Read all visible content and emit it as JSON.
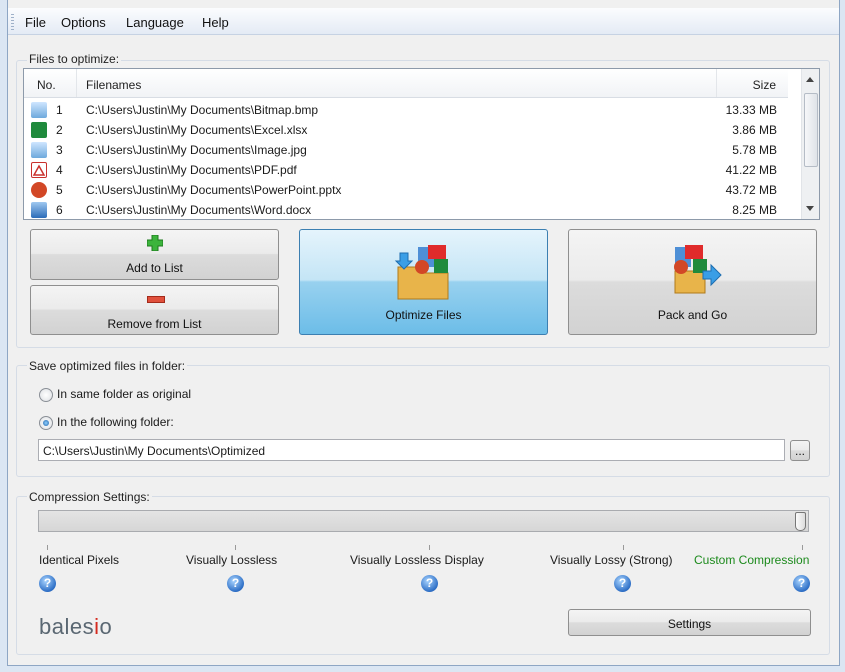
{
  "menu": [
    "File",
    "Options",
    "Language",
    "Help"
  ],
  "files_group": {
    "title": "Files to optimize:",
    "columns": {
      "no": "No.",
      "filename": "Filenames",
      "size": "Size"
    },
    "rows": [
      {
        "no": "1",
        "name": "C:\\Users\\Justin\\My Documents\\Bitmap.bmp",
        "size": "13.33 MB",
        "icon": "image-icon"
      },
      {
        "no": "2",
        "name": "C:\\Users\\Justin\\My Documents\\Excel.xlsx",
        "size": "3.86 MB",
        "icon": "excel-icon"
      },
      {
        "no": "3",
        "name": "C:\\Users\\Justin\\My Documents\\Image.jpg",
        "size": "5.78 MB",
        "icon": "image-icon"
      },
      {
        "no": "4",
        "name": "C:\\Users\\Justin\\My Documents\\PDF.pdf",
        "size": "41.22 MB",
        "icon": "pdf-icon"
      },
      {
        "no": "5",
        "name": "C:\\Users\\Justin\\My Documents\\PowerPoint.pptx",
        "size": "43.72 MB",
        "icon": "powerpoint-icon"
      },
      {
        "no": "6",
        "name": "C:\\Users\\Justin\\My Documents\\Word.docx",
        "size": "8.25 MB",
        "icon": "word-icon"
      }
    ],
    "buttons": {
      "add": "Add to List",
      "remove": "Remove from List",
      "optimize": "Optimize Files",
      "pack": "Pack and Go"
    }
  },
  "folder_group": {
    "title": "Save optimized files in folder:",
    "option_same": "In same folder as original",
    "option_following": "In the following folder:",
    "selected": "following",
    "path": "C:\\Users\\Justin\\My Documents\\Optimized",
    "browse": "..."
  },
  "compression_group": {
    "title": "Compression Settings:",
    "slider_level": 1.0,
    "levels": [
      "Identical Pixels",
      "Visually Lossless",
      "Visually Lossless Display",
      "Visually Lossy (Strong)",
      "Custom Compression"
    ],
    "help_glyph": "?",
    "settings_button": "Settings"
  },
  "logo": {
    "main": "bales",
    "accent": "i",
    "end": "o"
  },
  "colors": {
    "custom_compression": "#1c8a1c",
    "logo_accent": "#d42a1e",
    "optimize_button": "#98d1ef"
  }
}
